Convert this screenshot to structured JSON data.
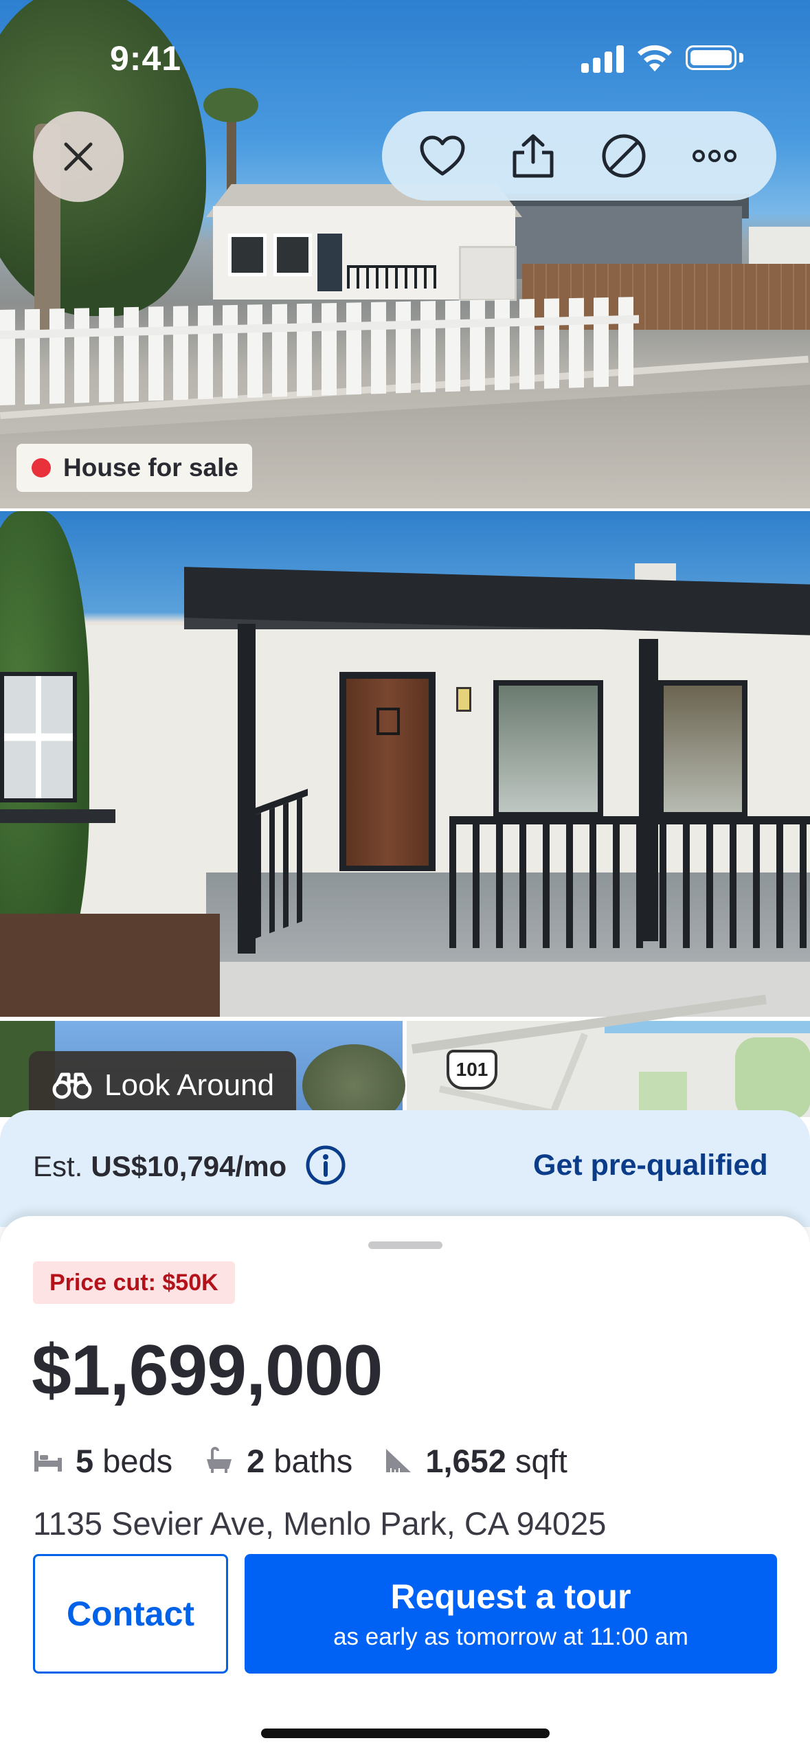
{
  "status_bar": {
    "time": "9:41"
  },
  "top_actions": {
    "close_icon": "close-icon",
    "icons": [
      "heart-icon",
      "share-icon",
      "hide-icon",
      "more-icon"
    ]
  },
  "photo1": {
    "badge_label": "House for sale",
    "badge_dot_color": "#e8313a"
  },
  "photo3": {
    "look_around_label": "Look Around",
    "map_shield": "101"
  },
  "estimate": {
    "prefix": "Est.",
    "amount": "US$10,794/mo",
    "link": "Get pre-qualified"
  },
  "listing": {
    "price_cut": "Price cut: $50K",
    "price": "$1,699,000",
    "beds_value": "5",
    "beds_label": "beds",
    "baths_value": "2",
    "baths_label": "baths",
    "sqft_value": "1,652",
    "sqft_label": "sqft",
    "address": "1135 Sevier Ave, Menlo Park, CA 94025"
  },
  "buttons": {
    "contact": "Contact",
    "tour_title": "Request a tour",
    "tour_subtitle": "as early as tomorrow at 11:00 am"
  },
  "colors": {
    "primary": "#0062f5",
    "price_cut_text": "#b4121b",
    "estimate_band": "#dfeefa"
  }
}
